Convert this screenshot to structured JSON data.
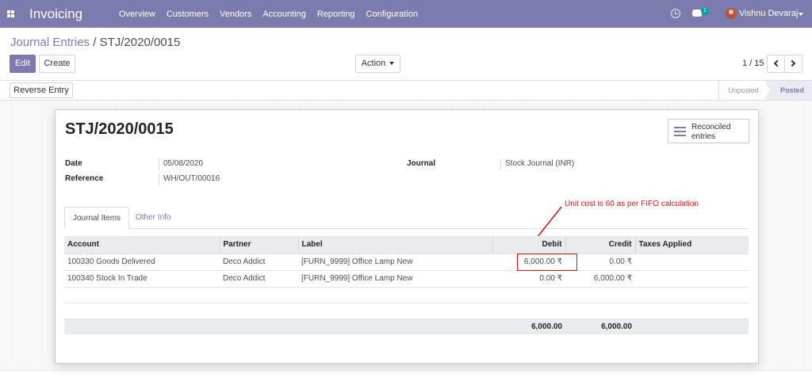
{
  "navbar": {
    "app_title": "Invoicing",
    "menu": [
      "Overview",
      "Customers",
      "Vendors",
      "Accounting",
      "Reporting",
      "Configuration"
    ],
    "chat_badge": "1",
    "user_name": "Vishnu Devaraj"
  },
  "breadcrumb": {
    "parent": "Journal Entries",
    "separator": "/",
    "current": "STJ/2020/0015"
  },
  "buttons": {
    "edit": "Edit",
    "create": "Create",
    "action": "Action",
    "reverse": "Reverse Entry"
  },
  "pager": {
    "value": "1 / 15"
  },
  "status": {
    "stages": [
      "Unposted",
      "Posted"
    ],
    "current": "Posted"
  },
  "record": {
    "title": "STJ/2020/0015",
    "reconciled_label": "Reconciled entries",
    "date_label": "Date",
    "date_value": "05/08/2020",
    "reference_label": "Reference",
    "reference_value": "WH/OUT/00016",
    "journal_label": "Journal",
    "journal_value": "Stock Journal (INR)"
  },
  "tabs": [
    "Journal Items",
    "Other Info"
  ],
  "annotation": "Unit cost is 60 as per FIFO calculation",
  "table": {
    "headers": [
      "Account",
      "Partner",
      "Label",
      "Debit",
      "Credit",
      "Taxes Applied"
    ],
    "rows": [
      [
        "100330 Goods Delivered",
        "Deco Addict",
        "[FURN_9999] Office Lamp New",
        "6,000.00 ₹",
        "0.00 ₹",
        ""
      ],
      [
        "100340 Stock In Trade",
        "Deco Addict",
        "[FURN_9999] Office Lamp New",
        "0.00 ₹",
        "6,000.00 ₹",
        ""
      ]
    ],
    "totals": {
      "debit": "6,000.00",
      "credit": "6,000.00"
    }
  },
  "colors": {
    "brand": "#7c7bad",
    "annotation": "#e31212",
    "badge": "#00a09d"
  }
}
